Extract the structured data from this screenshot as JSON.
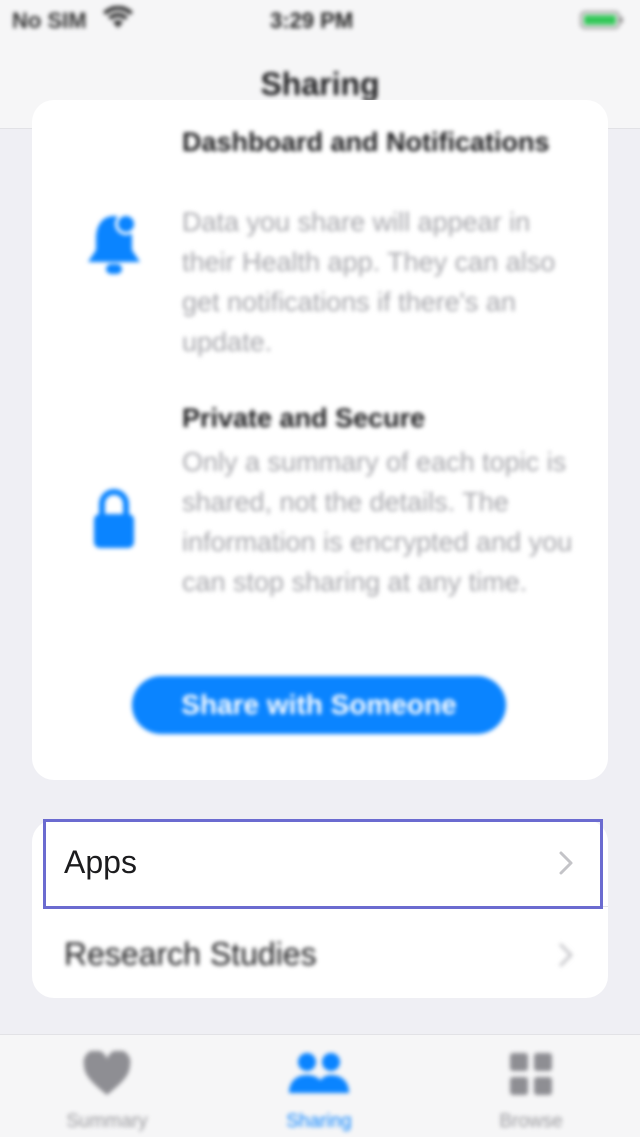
{
  "status_bar": {
    "carrier": "No SIM",
    "time": "3:29 PM",
    "wifi_icon": "wifi-icon",
    "battery_icon": "battery-icon"
  },
  "nav": {
    "title": "Sharing"
  },
  "features": [
    {
      "icon": "bell-badge-icon",
      "title": "Dashboard and Notifications",
      "description": "Data you share will appear in their Health app. They can also get notifications if there's an update."
    },
    {
      "icon": "lock-icon",
      "title": "Private and Secure",
      "description": "Only a summary of each topic is shared, not the details. The information is encrypted and you can stop sharing at any time."
    }
  ],
  "share_button": {
    "label": "Share with Someone"
  },
  "list": [
    {
      "label": "Apps",
      "icon": "chevron-right-icon"
    },
    {
      "label": "Research Studies",
      "icon": "chevron-right-icon"
    }
  ],
  "tabs": [
    {
      "label": "Summary",
      "icon": "heart-icon",
      "active": false
    },
    {
      "label": "Sharing",
      "icon": "people-icon",
      "active": true
    },
    {
      "label": "Browse",
      "icon": "grid-icon",
      "active": false
    }
  ],
  "colors": {
    "accent": "#0a84ff",
    "highlight": "#6b6bd0"
  }
}
